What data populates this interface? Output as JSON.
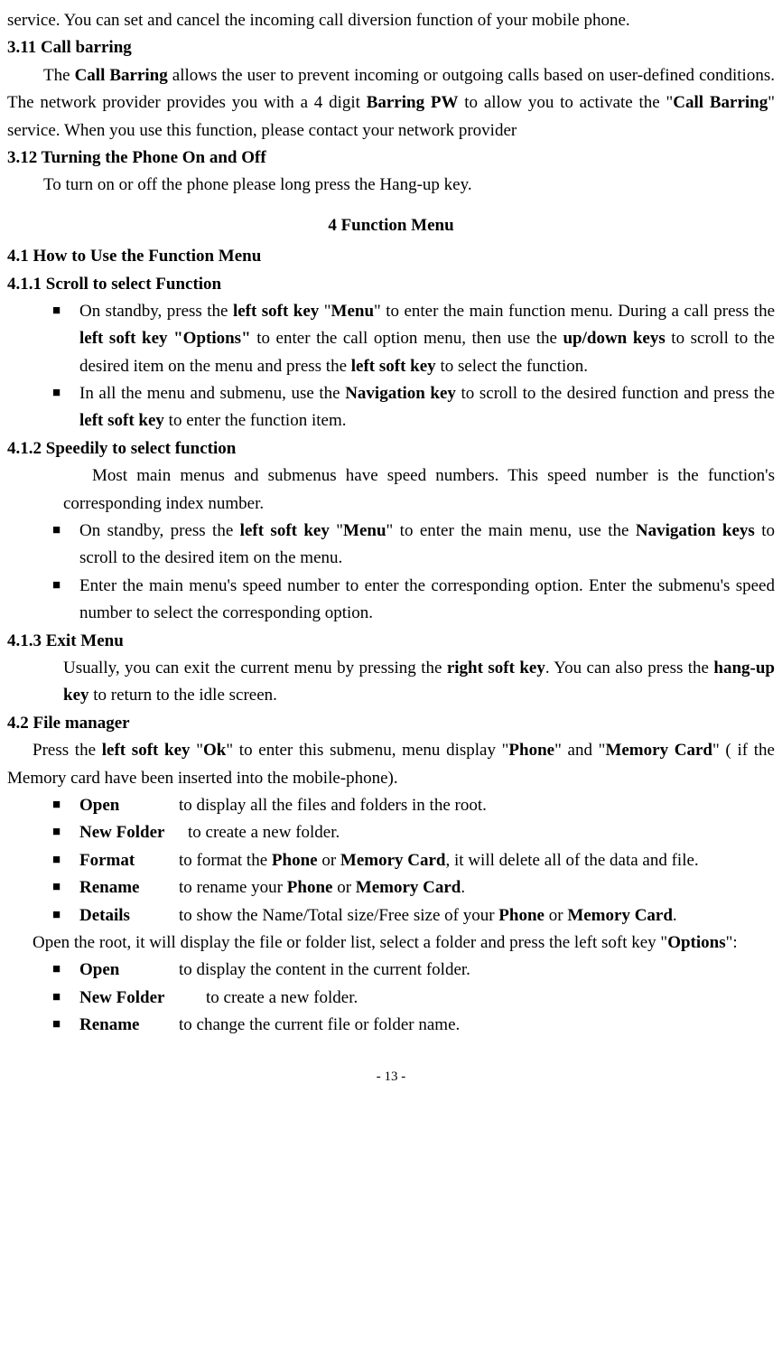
{
  "intro_line": "service. You can set and cancel the incoming call diversion function of your mobile phone.",
  "h_311": "3.11 Call barring",
  "p_311_a": "The ",
  "p_311_b": "Call Barring",
  "p_311_c": " allows the user to prevent incoming or outgoing calls based on user-defined conditions. The network provider provides you with a 4 digit ",
  "p_311_d": "Barring PW",
  "p_311_e": " to allow you to activate the \"",
  "p_311_f": "Call Barring",
  "p_311_g": "\" service. When you use this function, please contact your network provider",
  "h_312": "3.12 Turning the Phone On and Off",
  "p_312": "To turn on or off the phone please long press the Hang-up key.",
  "h_4": "4      Function Menu",
  "h_41": "4.1 How to Use the Function Menu",
  "h_411": "4.1.1 Scroll to select Function",
  "b411_1a": "On standby, press the ",
  "b411_1b": "left soft key",
  "b411_1c": " \"",
  "b411_1d": "Menu",
  "b411_1e": "\" to enter the main function menu. During a call press the ",
  "b411_1f": "left soft key \"Options\"",
  "b411_1g": " to enter the call option menu, then use the ",
  "b411_1h": "up/down keys",
  "b411_1i": " to scroll to the desired item on the menu and press the ",
  "b411_1j": "left soft key",
  "b411_1k": " to select the function.",
  "b411_2a": "In all the menu and submenu, use the ",
  "b411_2b": "Navigation key",
  "b411_2c": " to scroll to the desired function and press the ",
  "b411_2d": "left soft key",
  "b411_2e": " to enter the function item.",
  "h_412": "4.1.2 Speedily to select function",
  "p_412": "Most main menus and submenus have speed numbers. This speed number is the function's corresponding index number.",
  "b412_1a": "On standby, press the ",
  "b412_1b": "left soft key",
  "b412_1c": " \"",
  "b412_1d": "Menu",
  "b412_1e": "\" to enter the main menu, use the ",
  "b412_1f": "Navigation keys",
  "b412_1g": " to scroll to the desired item on the menu.",
  "b412_2": "Enter the main menu's speed number to enter the corresponding option. Enter the submenu's speed number to select the corresponding option.",
  "h_413": "4.1.3 Exit Menu",
  "p_413a": "Usually, you can exit the current menu by pressing the ",
  "p_413b": "right soft key",
  "p_413c": ". You can also press the ",
  "p_413d": "hang-up key",
  "p_413e": " to return to the idle screen.",
  "h_42": "4.2 File manager",
  "p_42a": "Press the ",
  "p_42b": "left soft key",
  "p_42c": " \"",
  "p_42d": "Ok",
  "p_42e": "\" to enter this submenu, menu display \"",
  "p_42f": "Phone",
  "p_42g": "\" and \"",
  "p_42h": "Memory Card",
  "p_42i": "\" ( if the Memory card have been inserted into the mobile-phone).",
  "d1_term": "Open",
  "d1_desc": "to display all the files and folders in the root.",
  "d2_term": "New Folder",
  "d2_desc": "to create a new folder.",
  "d3_term": "Format",
  "d3_desc_a": "to format the ",
  "d3_desc_b": "Phone",
  "d3_desc_c": " or ",
  "d3_desc_d": "Memory Card",
  "d3_desc_e": ", it will delete all of the data and file.",
  "d4_term": "Rename",
  "d4_desc_a": "to rename your ",
  "d4_desc_b": "Phone",
  "d4_desc_c": " or ",
  "d4_desc_d": "Memory Card",
  "d4_desc_e": ".",
  "d5_term": "Details",
  "d5_desc_a": "to show the Name/Total size/Free size of your ",
  "d5_desc_b": "Phone",
  "d5_desc_c": " or ",
  "d5_desc_d": "Memory Card",
  "d5_desc_e": ".",
  "p_open_a": "Open the root, it will display the file or folder list, select a folder and press the left soft key \"",
  "p_open_b": "Options",
  "p_open_c": "\":",
  "e1_term": "Open",
  "e1_desc": "to display the content in the current folder.",
  "e2_term": "New Folder",
  "e2_desc": "to create a new folder.",
  "e3_term": "Rename",
  "e3_desc": "to change the current file or folder name.",
  "page_num": "- 13 -"
}
